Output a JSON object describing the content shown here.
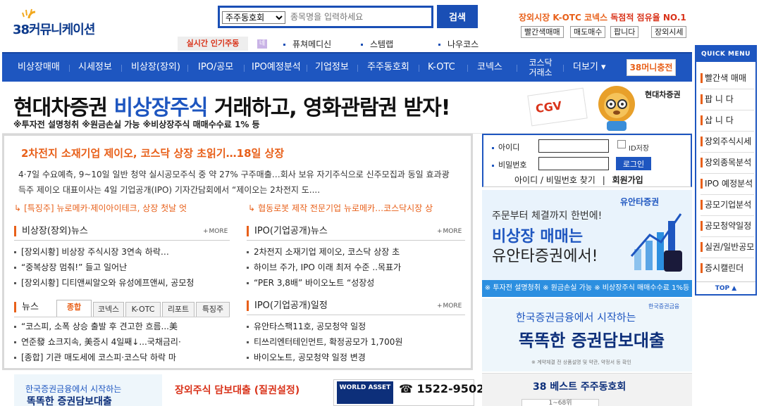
{
  "header": {
    "logo_text": "38커뮤니케이션",
    "search_select": "주주동호회",
    "search_placeholder": "종목명을 입력하세요",
    "search_button": "검색",
    "promo_prefix": "장외시장 K-OTC 코넥스 ",
    "promo_highlight": "독점적 점유율 NO.1",
    "top_buttons": [
      "빨간색매매",
      "매도매수",
      "팝니다",
      "장외시세"
    ],
    "hot_label": "실시간 인기주동",
    "hot_num": "네",
    "hot_items": [
      "퓨쳐메디신",
      "스템랩",
      "나우코스"
    ]
  },
  "nav": {
    "items": [
      "비상장매매",
      "시세정보",
      "비상장(장외)",
      "IPO/공모",
      "IPO예정분석",
      "기업정보",
      "주주동호회",
      "K-OTC",
      "코넥스",
      "코스닥 거래소",
      "더보기 ▾"
    ],
    "charge": "38머니충전"
  },
  "banner": {
    "title_a": "현대차증권 ",
    "title_b": "비상장주식",
    "title_c": " 거래하고, 영화관람권 받자!",
    "sub": "※투자전 설명청취 ※원금손실 가능 ※비상장주식 매매수수료 1% 등",
    "ticket": "CGV",
    "brand": "현대차증권"
  },
  "main": {
    "headline": "2차전지 소재기업 제이오, 코스닥 상장 초읽기…18일 상장",
    "lead": "4·7일 수요예측, 9~10일 일반 청약 실시공모주식 중 약 27% 구주매출…회사 보유 자기주식으로 신주모집과 동일 효과광득주 제이오 대표이사는 4일 기업공개(IPO) 기자간담회에서 “제이오는 2차전지 도....",
    "sub_heads": [
      "[특징주] 뉴로메카·제이아이테크, 상장 첫날 엇",
      "협동로봇 제작 전문기업 뉴로메카…코스닥시장 상"
    ],
    "more": "MORE",
    "sections": {
      "otc": {
        "title": "비상장(장외)뉴스",
        "items": [
          "[장외시황] 비상장 주식시장 3연속 하락…",
          "“중복상장 멈춰!” 들고 일어난",
          "[장외시황] 디티앤씨알오와 유성에프앤씨, 공모청"
        ]
      },
      "ipo_news": {
        "title": "IPO(기업공개)뉴스",
        "items": [
          "2차전지 소재기업 제이오, 코스닥 상장 초",
          "하이브 주가, IPO 이래 최저 수준 ..목표가",
          "“PER 3,8배” 바이오노트 “성장성"
        ]
      },
      "news": {
        "title": "뉴스",
        "tabs": [
          "종합",
          "코넥스",
          "K-OTC",
          "리포트",
          "특징주"
        ],
        "items": [
          "“코스피, 소폭 상승 출발 후 견고한 흐름...美",
          "연준發 쇼크지속, 美증시 4일째↓...국채금리·",
          "[종합] 기관 매도세에 코스피·코스닥 하락 마"
        ]
      },
      "ipo_schedule": {
        "title": "IPO(기업공개)일정",
        "items": [
          "유안타스팩11호, 공모청약 일정",
          "티쓰리엔터테인먼트, 확정공모가 1,700원",
          "바이오노트, 공모청약 일정 변경"
        ]
      }
    }
  },
  "login": {
    "id_label": "아이디",
    "pw_label": "비밀번호",
    "save_label": "ID저장",
    "login_button": "로그인",
    "find_link": "아이디 / 비밀번호 찾기",
    "separator": "|",
    "join_link": "회원가입"
  },
  "ad_yuanta": {
    "brand": "유안타증권",
    "line1": "주문부터 체결까지 한번에!",
    "line2": "비상장 매매는",
    "line3": "유안타증권에서!",
    "foot": "※ 투자전 설명청취 ※ 원금손실 가능 ※ 비상장주식 매매수수료 1%등"
  },
  "ad_korea": {
    "brand": "한국증권금융",
    "line1": "한국증권금융에서 시작하는",
    "line2": "똑똑한 증권담보대출",
    "fine": "※ 계약체결 전 상품설명 및 약관, 약정서 등 확인"
  },
  "quick": {
    "title": "QUICK MENU",
    "items": [
      "빨간색 매매",
      "팝 니 다",
      "삽 니 다",
      "장외주식시세",
      "장외종목분석",
      "IPO 예정분석",
      "공모기업분석",
      "공모청약일정",
      "실권/일반공모",
      "증시캘린더"
    ],
    "top": "TOP ▲"
  },
  "bottom": {
    "ad1_line1": "한국증권금융에서 시작하는",
    "ad1_line2": "똑똑한 증권담보대출",
    "ad2_line1": "장외주식 담보대출 (질권설정)",
    "ad3_logo": "WORLD ASSET",
    "ad3_phone": "☎ 1522-9502",
    "best_title": "38 베스트 주주동호회",
    "best_tab": "1~68위"
  }
}
